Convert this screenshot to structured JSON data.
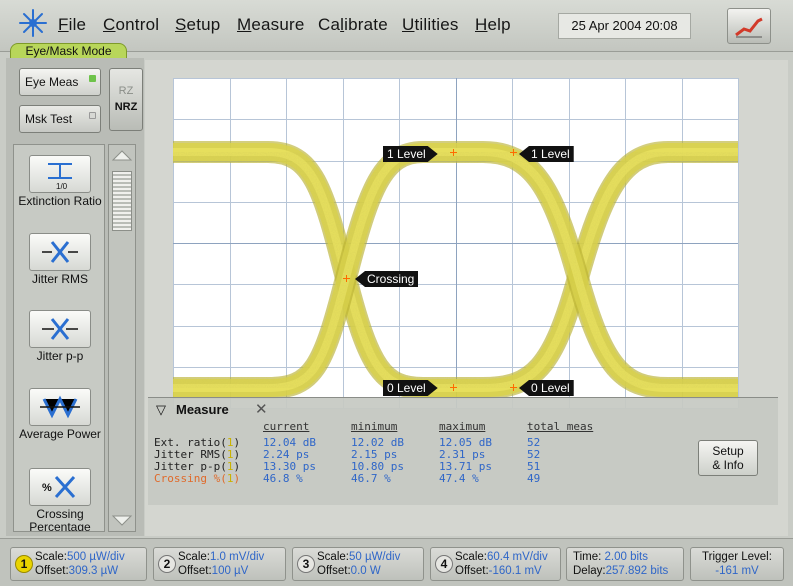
{
  "menu": {
    "items": [
      {
        "label": "File",
        "u": "F",
        "rest": "ile"
      },
      {
        "label": "Control",
        "u": "C",
        "rest": "ontrol"
      },
      {
        "label": "Setup",
        "u": "S",
        "rest": "etup"
      },
      {
        "label": "Measure",
        "u": "M",
        "rest": "easure"
      },
      {
        "label": "Calibrate",
        "pre": "Ca",
        "u": "l",
        "rest": "ibrate"
      },
      {
        "label": "Utilities",
        "u": "U",
        "rest": "tilities"
      },
      {
        "label": "Help",
        "u": "H",
        "rest": "elp"
      }
    ],
    "datetime": "25 Apr 2004   20:08"
  },
  "mode_tab": "Eye/Mask Mode",
  "left_panel": {
    "eye_meas": "Eye Meas",
    "msk_test": "Msk Test",
    "rz": "RZ",
    "nrz": "NRZ",
    "measurements": [
      {
        "label": "Extinction Ratio",
        "icon": "extinction-ratio-icon"
      },
      {
        "label": "Jitter RMS",
        "icon": "jitter-rms-icon"
      },
      {
        "label": "Jitter p-p",
        "icon": "jitter-pp-icon"
      },
      {
        "label": "Average Power",
        "icon": "average-power-icon"
      },
      {
        "label": "Crossing Percentage",
        "icon": "crossing-percentage-icon"
      }
    ]
  },
  "eye": {
    "labels": {
      "level1_left": "1 Level",
      "level1_right": "1 Level",
      "crossing": "Crossing",
      "level0_left": "0 Level",
      "level0_right": "0 Level"
    },
    "colors": {
      "trace": "#d9d24a",
      "trace_dark": "#b6ad2a",
      "marker": "#ff6a00"
    }
  },
  "measure_panel": {
    "title": "Measure",
    "columns": [
      "current",
      "minimum",
      "maximum",
      "total meas"
    ],
    "rows": [
      {
        "label": "Ext. ratio(",
        "ch": "1",
        "close": ")",
        "current": "12.04 dB",
        "minimum": "12.02 dB",
        "maximum": "12.05 dB",
        "total": "52"
      },
      {
        "label": "Jitter RMS(",
        "ch": "1",
        "close": ")",
        "current": "2.24 ps",
        "minimum": "2.15 ps",
        "maximum": "2.31 ps",
        "total": "52"
      },
      {
        "label": "Jitter p-p(",
        "ch": "1",
        "close": ")",
        "current": "13.30 ps",
        "minimum": "10.80 ps",
        "maximum": "13.71 ps",
        "total": "51"
      },
      {
        "label": "Crossing %(",
        "ch": "1",
        "close": ")",
        "current": "46.8 %",
        "minimum": "46.7 %",
        "maximum": "47.4 %",
        "total": "49"
      }
    ],
    "setup_info": [
      "Setup",
      "& Info"
    ]
  },
  "channels": [
    {
      "num": "1",
      "scale_key": "Scale:",
      "scale": "500 µW/div",
      "offset_key": "Offset:",
      "offset": "309.3 µW"
    },
    {
      "num": "2",
      "scale_key": "Scale:",
      "scale": "1.0 mV/div",
      "offset_key": "Offset:",
      "offset": "100 µV"
    },
    {
      "num": "3",
      "scale_key": "Scale:",
      "scale": "50 µW/div",
      "offset_key": "Offset:",
      "offset": "0.0 W"
    },
    {
      "num": "4",
      "scale_key": "Scale:",
      "scale": "60.4 mV/div",
      "offset_key": "Offset:",
      "offset": "-160.1 mV"
    }
  ],
  "timebase": {
    "time_key": "Time:",
    "time": "2.00 bits",
    "delay_key": "Delay:",
    "delay": "257.892 bits"
  },
  "trigger": {
    "label": "Trigger Level:",
    "value": "-161 mV"
  }
}
